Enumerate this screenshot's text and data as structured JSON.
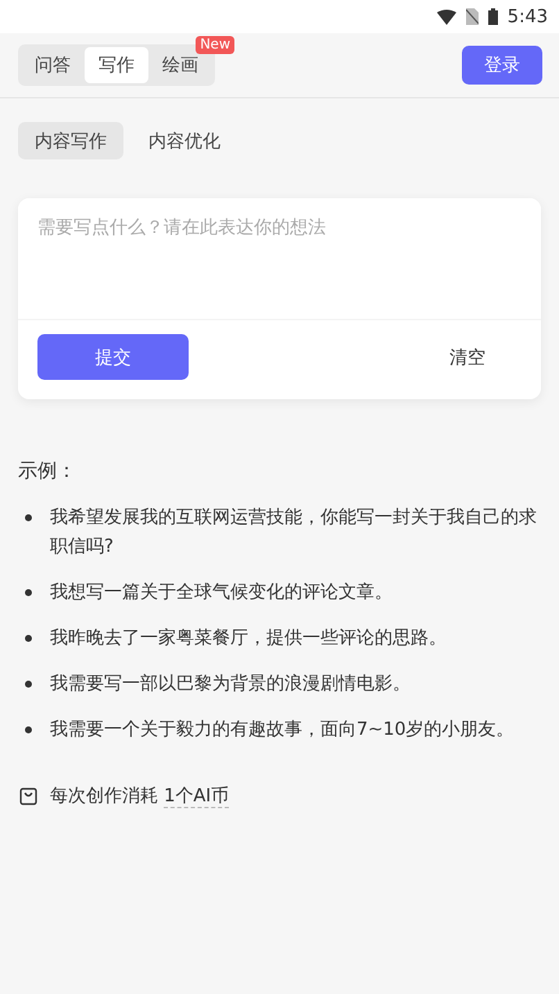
{
  "status_bar": {
    "time": "5:43"
  },
  "tabs": [
    {
      "label": "问答",
      "selected": false
    },
    {
      "label": "写作",
      "selected": true
    },
    {
      "label": "绘画",
      "selected": false,
      "badge": "New"
    }
  ],
  "login_button": "登录",
  "subtabs": [
    {
      "label": "内容写作",
      "selected": true
    },
    {
      "label": "内容优化",
      "selected": false
    }
  ],
  "editor": {
    "placeholder": "需要写点什么？请在此表达你的想法",
    "submit": "提交",
    "clear": "清空"
  },
  "examples": {
    "title": "示例：",
    "items": [
      "我希望发展我的互联网运营技能，你能写一封关于我自己的求职信吗?",
      "我想写一篇关于全球气候变化的评论文章。",
      "我昨晚去了一家粤菜餐厅，提供一些评论的思路。",
      "我需要写一部以巴黎为背景的浪漫剧情电影。",
      "我需要一个关于毅力的有趣故事，面向7~10岁的小朋友。"
    ]
  },
  "cost": {
    "text": "每次创作消耗 ",
    "amount": "1个AI币"
  }
}
